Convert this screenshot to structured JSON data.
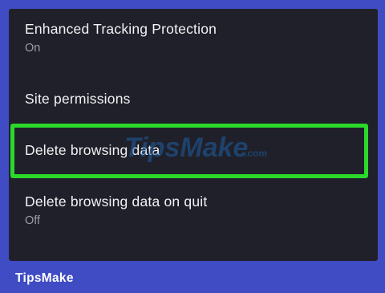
{
  "settings": {
    "items": [
      {
        "title": "Enhanced Tracking Protection",
        "subtitle": "On"
      },
      {
        "title": "Site permissions"
      },
      {
        "title": "Delete browsing data",
        "highlighted": true
      },
      {
        "title": "Delete browsing data on quit",
        "subtitle": "Off"
      }
    ]
  },
  "watermark": {
    "brand": "TipsMake",
    "suffix": ".com"
  },
  "footer": {
    "brand": "TipsMake"
  },
  "colors": {
    "frame": "#3f4cc4",
    "screen_bg": "#20202a",
    "highlight": "#2bd92b",
    "text_primary": "#f2f2f5",
    "text_secondary": "#9c9ca6"
  }
}
